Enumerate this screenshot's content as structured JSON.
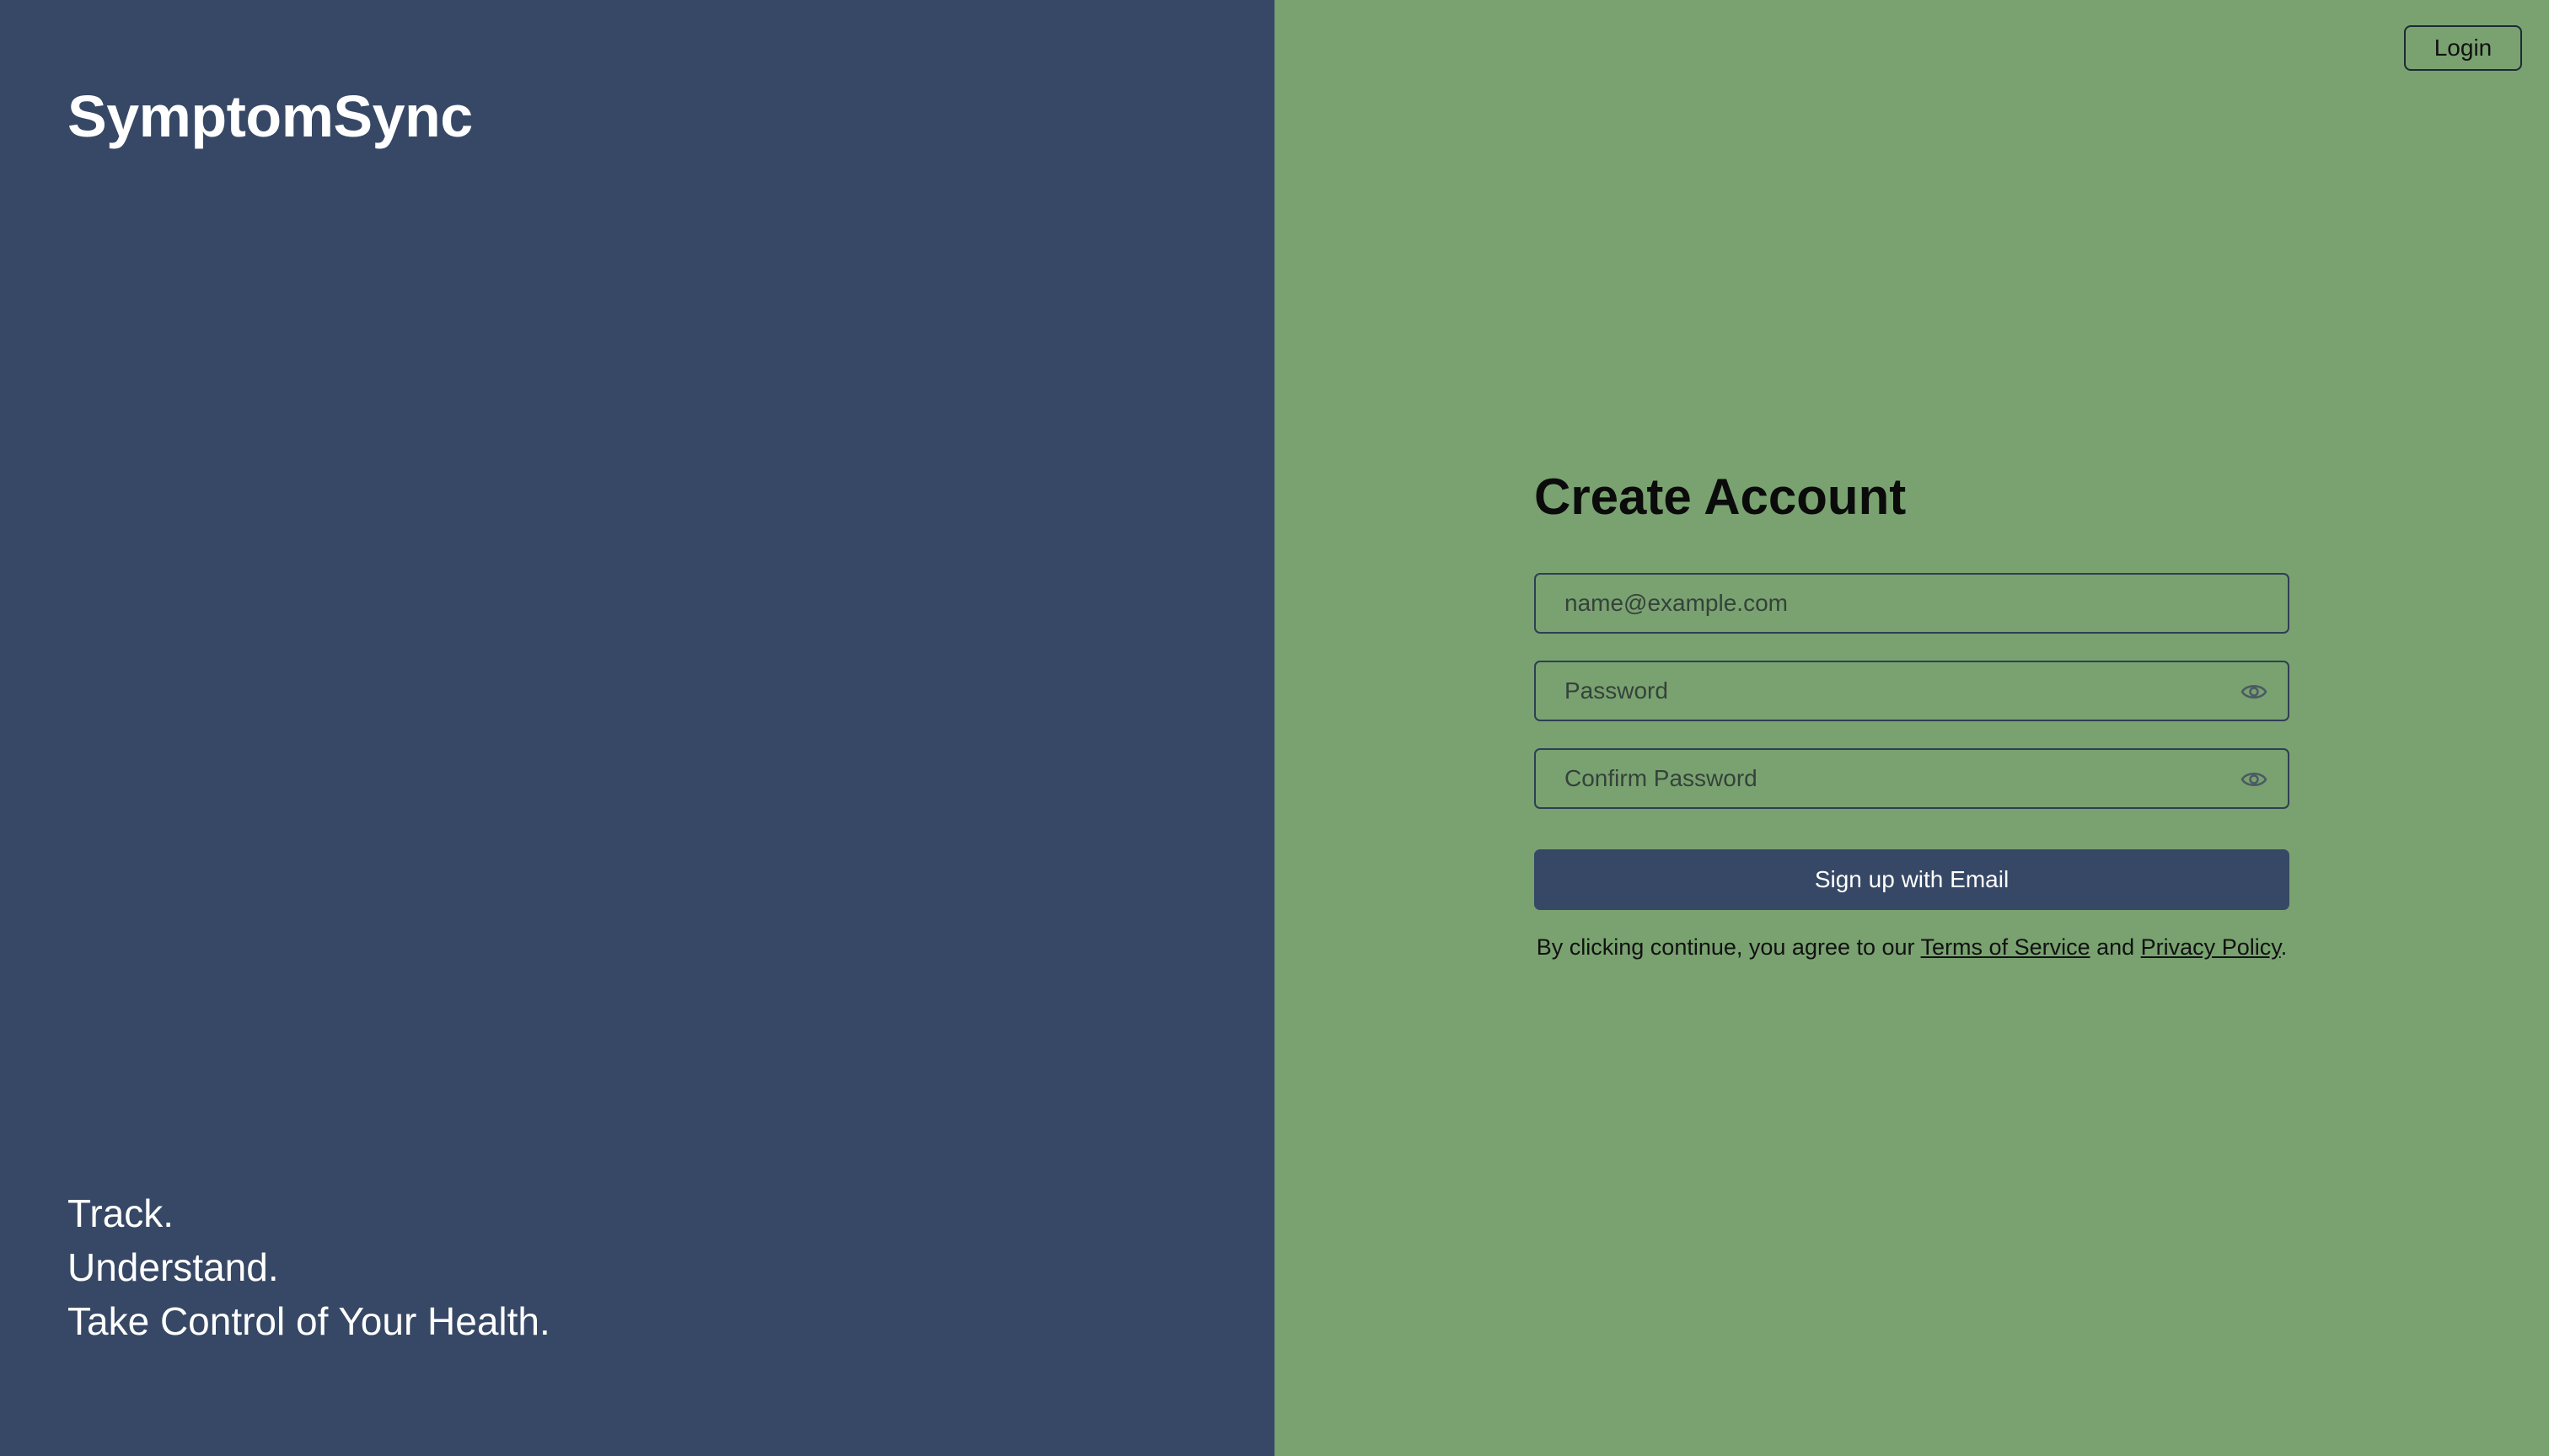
{
  "brand": {
    "name": "SymptomSync"
  },
  "tagline": {
    "line1": "Track.",
    "line2": "Understand.",
    "line3": "Take Control of Your Health."
  },
  "header": {
    "login_label": "Login"
  },
  "form": {
    "title": "Create Account",
    "email_placeholder": "name@example.com",
    "email_value": "",
    "password_placeholder": "Password",
    "password_value": "",
    "confirm_password_placeholder": "Confirm Password",
    "confirm_password_value": "",
    "password_toggle_icon": "eye-icon",
    "confirm_toggle_icon": "eye-icon",
    "submit_label": "Sign up with Email"
  },
  "legal": {
    "prefix": "By clicking continue, you agree to our ",
    "terms_label": "Terms of Service",
    "conjunction": " and ",
    "privacy_label": "Privacy Policy",
    "suffix": "."
  },
  "colors": {
    "left_background": "#364865",
    "right_background": "#79a270",
    "primary_button": "#364865",
    "border": "#2f3e54"
  }
}
